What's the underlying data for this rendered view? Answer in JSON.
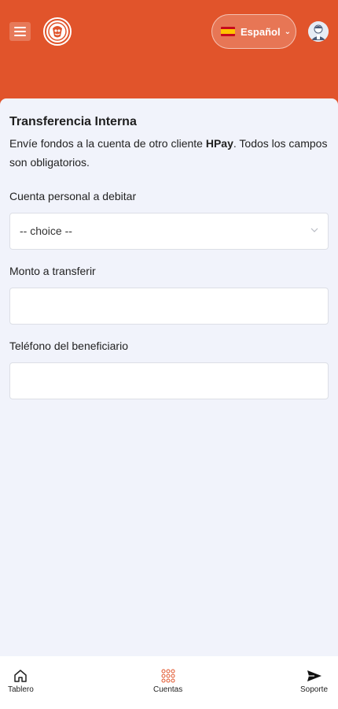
{
  "header": {
    "menu_icon": "hamburger-icon",
    "logo_icon": "brand-logo-icon",
    "language": {
      "label": "Español",
      "flag_icon": "spain-flag-icon",
      "chevron": "⌄"
    },
    "avatar_icon": "user-avatar-icon"
  },
  "colors": {
    "accent": "#e1542b",
    "background": "#f1f3fb",
    "field_border": "#dcdfe6"
  },
  "form": {
    "title": "Transferencia Interna",
    "description_before": "Envíe fondos a la cuenta de otro cliente ",
    "description_brand": "HPay",
    "description_after": ". Todos los campos son obligatorios.",
    "debit_account": {
      "label": "Cuenta personal a debitar",
      "value": "-- choice --"
    },
    "amount": {
      "label": "Monto a transferir",
      "value": "",
      "placeholder": ""
    },
    "beneficiary_phone": {
      "label": "Teléfono del beneficiario",
      "value": "",
      "placeholder": ""
    }
  },
  "bottom_nav": {
    "items": [
      {
        "label": "Tablero",
        "icon": "home-icon"
      },
      {
        "label": "Cuentas",
        "icon": "grid-icon"
      },
      {
        "label": "Soporte",
        "icon": "send-icon"
      }
    ]
  }
}
